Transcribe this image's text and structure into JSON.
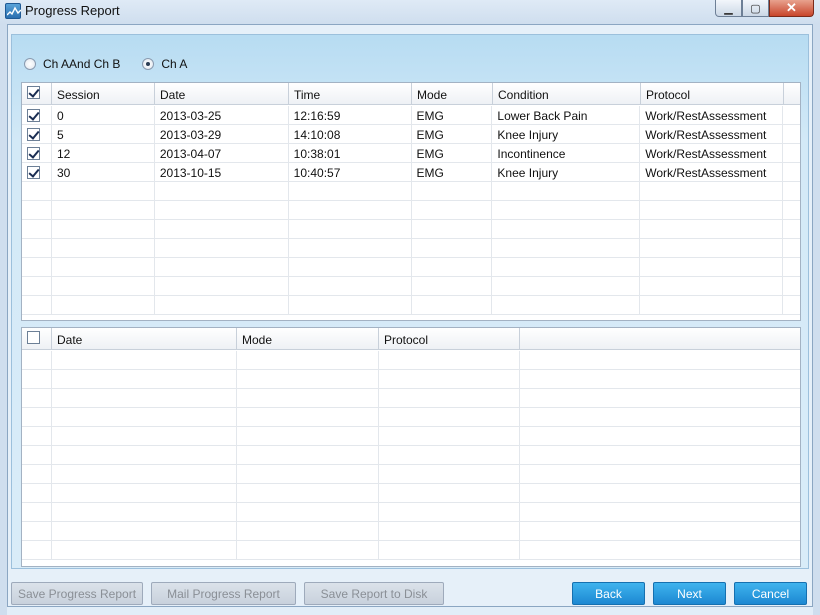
{
  "window": {
    "title": "Progress Report",
    "minimize_glyph": "▁",
    "maximize_glyph": "▢",
    "close_glyph": "✕"
  },
  "channel_options": {
    "options": [
      {
        "label": "Ch AAnd Ch B",
        "selected": false
      },
      {
        "label": "Ch A",
        "selected": true
      }
    ]
  },
  "sessions_table": {
    "header_checkbox_checked": true,
    "columns": [
      "Session",
      "Date",
      "Time",
      "Mode",
      "Condition",
      "Protocol"
    ],
    "rows": [
      {
        "checked": true,
        "session": "0",
        "date": "2013-03-25",
        "time": "12:16:59",
        "mode": "EMG",
        "condition": "Lower Back Pain",
        "protocol": "Work/RestAssessment"
      },
      {
        "checked": true,
        "session": "5",
        "date": "2013-03-29",
        "time": "14:10:08",
        "mode": "EMG",
        "condition": "Knee Injury",
        "protocol": "Work/RestAssessment"
      },
      {
        "checked": true,
        "session": "12",
        "date": "2013-04-07",
        "time": "10:38:01",
        "mode": "EMG",
        "condition": "Incontinence",
        "protocol": "Work/RestAssessment"
      },
      {
        "checked": true,
        "session": "30",
        "date": "2013-10-15",
        "time": "10:40:57",
        "mode": "EMG",
        "condition": "Knee Injury",
        "protocol": "Work/RestAssessment"
      }
    ]
  },
  "reports_table": {
    "header_checkbox_checked": false,
    "columns": [
      "Date",
      "Mode",
      "Protocol"
    ],
    "rows": []
  },
  "buttons": {
    "save_progress": "Save Progress Report",
    "mail_progress": "Mail Progress Report",
    "save_to_disk": "Save Report to Disk",
    "back": "Back",
    "next": "Next",
    "cancel": "Cancel"
  },
  "colors": {
    "accent_button": "#1c88d2",
    "panel": "#d3e9f7"
  }
}
